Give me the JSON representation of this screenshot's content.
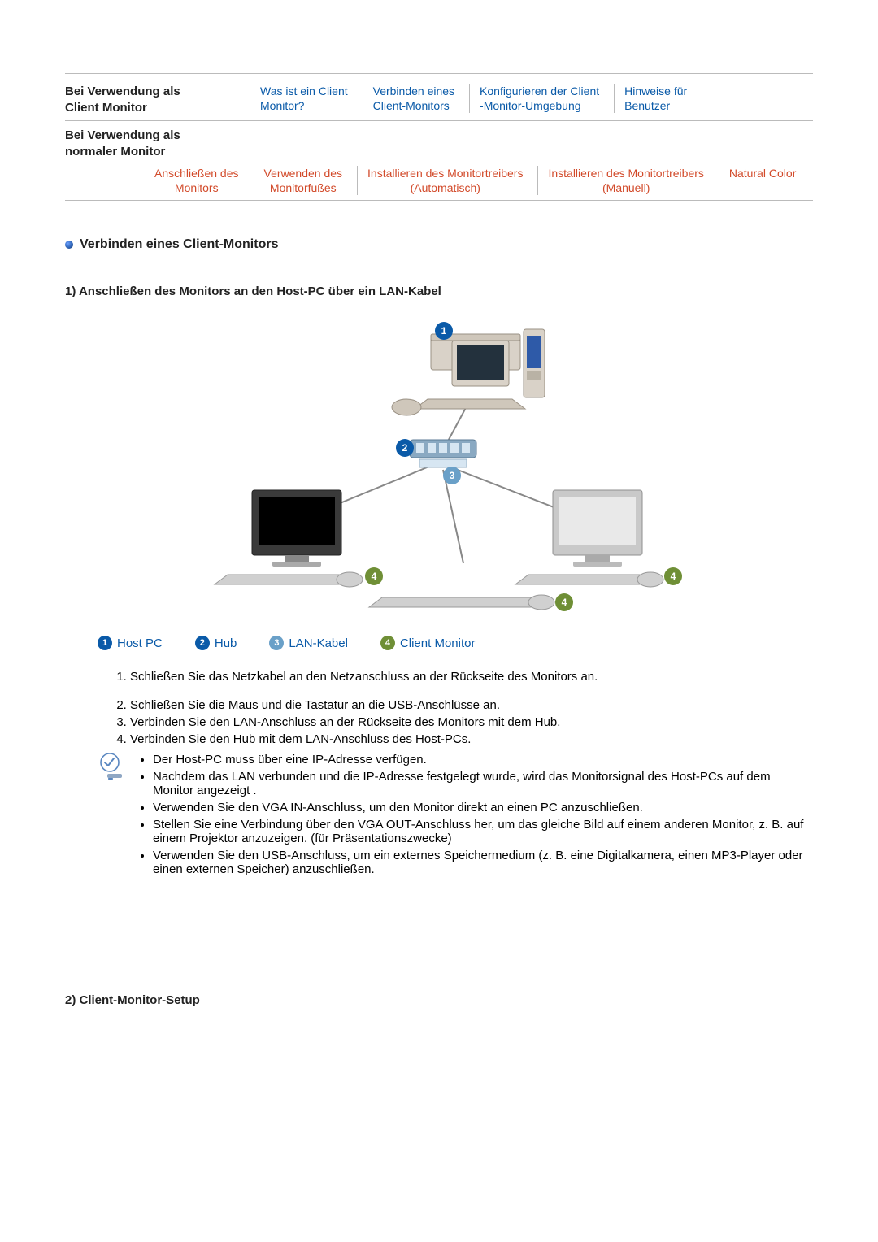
{
  "header1": {
    "label": "Bei Verwendung als\nClient Monitor",
    "tabs": [
      "Was ist ein Client\nMonitor?",
      "Verbinden eines\nClient-Monitors",
      "Konfigurieren der Client\n-Monitor-Umgebung",
      "Hinweise für\nBenutzer"
    ]
  },
  "header2": {
    "label": "Bei Verwendung als\nnormaler Monitor",
    "tabs": [
      "Anschließen des\nMonitors",
      "Verwenden des\nMonitorfußes",
      "Installieren des Monitortreibers\n(Automatisch)",
      "Installieren des Monitortreibers\n(Manuell)",
      "Natural Color"
    ]
  },
  "section_title": "Verbinden eines Client-Monitors",
  "subheading1": "1) Anschließen des Monitors an den Host-PC über ein LAN-Kabel",
  "legend": {
    "l1": "Host PC",
    "l2": "Hub",
    "l3": "LAN-Kabel",
    "l4": "Client Monitor"
  },
  "steps": [
    "Schließen Sie das Netzkabel an den Netzanschluss an der Rückseite des Monitors an.",
    "Schließen Sie die Maus und die Tastatur an die USB-Anschlüsse an.",
    "Verbinden Sie den LAN-Anschluss an der Rückseite des Monitors mit dem Hub.",
    "Verbinden Sie den Hub mit dem LAN-Anschluss des Host-PCs."
  ],
  "notes": [
    "Der Host-PC muss über eine IP-Adresse verfügen.",
    "Nachdem das LAN verbunden und die IP-Adresse festgelegt wurde, wird das Monitorsignal des Host-PCs auf dem Monitor angezeigt .",
    "Verwenden Sie den VGA IN-Anschluss, um den Monitor direkt an einen PC anzuschließen.",
    "Stellen Sie eine Verbindung über den VGA OUT-Anschluss her, um das gleiche Bild auf einem anderen Monitor, z. B. auf einem Projektor anzuzeigen. (für Präsentationszwecke)",
    "Verwenden Sie den USB-Anschluss, um ein externes Speichermedium (z. B. eine Digitalkamera, einen MP3-Player oder einen externen Speicher) anzuschließen."
  ],
  "subheading2": "2) Client-Monitor-Setup"
}
